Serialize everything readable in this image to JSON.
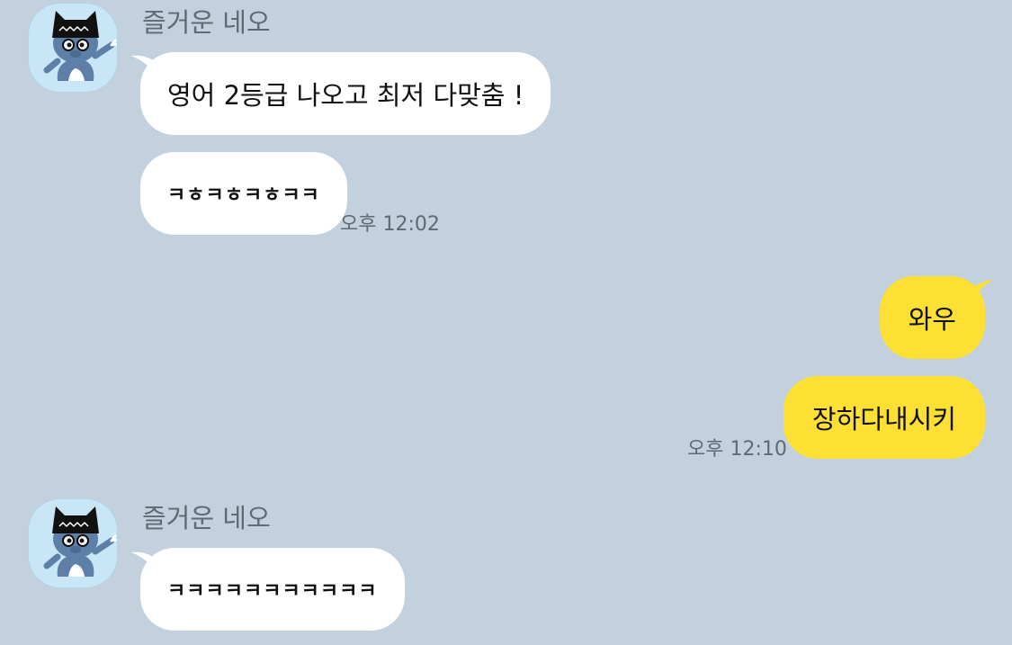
{
  "messages": [
    {
      "direction": "incoming",
      "sender": "즐거운 네오",
      "avatar_icon": "neo-character-avatar-icon",
      "bubbles": [
        "영어 2등급 나오고 최저 다맞춤 !",
        "ㅋㅎㅋㅎㅋㅎㅋㅋ"
      ],
      "time": "오후 12:02"
    },
    {
      "direction": "outgoing",
      "bubbles": [
        "와우",
        "장하다내시키"
      ],
      "time": "오후 12:10"
    },
    {
      "direction": "incoming",
      "sender": "즐거운 네오",
      "avatar_icon": "neo-character-avatar-icon",
      "bubbles": [
        "ㅋㅋㅋㅋㅋㅋㅋㅋㅋㅋㅋ"
      ]
    }
  ],
  "colors": {
    "background": "#c3d1de",
    "incoming_bubble": "#ffffff",
    "outgoing_bubble": "#fde033",
    "muted_text": "#5f6a72"
  }
}
